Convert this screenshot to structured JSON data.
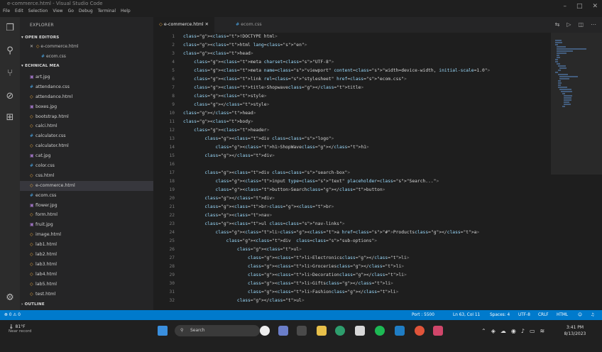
{
  "window": {
    "title": "e-commerce.html - Visual Studio Code"
  },
  "menu": [
    "File",
    "Edit",
    "Selection",
    "View",
    "Go",
    "Debug",
    "Terminal",
    "Help"
  ],
  "explorer": {
    "title": "EXPLORER",
    "open_editors_label": "OPEN EDITORS",
    "open_editors": [
      "e-commerce.html",
      "ecom.css"
    ],
    "folder_label": "ECHNICAL MEA",
    "files": [
      "art.jpg",
      "attendance.css",
      "attendance.html",
      "boxes.jpg",
      "bootstrap.html",
      "calci.html",
      "calculator.css",
      "calculator.html",
      "cat.jpg",
      "color.css",
      "css.html",
      "e-commerce.html",
      "ecom.css",
      "flower.jpg",
      "form.html",
      "fruit.jpg",
      "image.html",
      "lab1.html",
      "lab2.html",
      "lab3.html",
      "lab4.html",
      "lab5.html",
      "test.html"
    ],
    "selected_file": "e-commerce.html",
    "outline_label": "OUTLINE"
  },
  "tabs": [
    {
      "label": "e-commerce.html",
      "active": true
    },
    {
      "label": "ecom.css",
      "active": false
    }
  ],
  "editor": {
    "line_numbers": [
      "1",
      "2",
      "3",
      "4",
      "5",
      "6",
      "7",
      "8",
      "9",
      "10",
      "11",
      "12",
      "13",
      "14",
      "15",
      "16",
      "17",
      "18",
      "19",
      "20",
      "21",
      "22",
      "23",
      "24",
      "25",
      "26",
      "27",
      "28",
      "29",
      "30",
      "31",
      "32"
    ],
    "lines": [
      "<!DOCTYPE html>",
      "<html lang=\"en\">",
      "<head>",
      "    <meta charset=\"UTF-8\">",
      "    <meta name=\"viewport\" content=\"width=device-width, initial-scale=1.0\">",
      "    <link rel=\"stylesheet\" href=\"ecom.css\">",
      "    <title>Shopwave</title>",
      "    <style>",
      "    </style>",
      "</head>",
      "<body>",
      "    <header>",
      "        <div class=\"logo\">",
      "            <h1>ShopWave</h1>",
      "        </div>",
      "",
      "        <div class=\"search-box\">",
      "            <input type=\"text\" placeholder=\"Search...\">",
      "            <button>Search</button>",
      "        </div>",
      "        <br><br>",
      "        <nav>",
      "        <ul class=\"nav-links\">",
      "            <li><a href=\"#\">Products</a>",
      "                <div  class=\"sub-options\">",
      "                    <ul>",
      "                        <li>Electronics</li>",
      "                        <li>Groceries</li>",
      "                        <li>Decoration</li>",
      "                        <li>Gifts</li>",
      "                        <li>Fashion</li>",
      "                    </ul>"
    ]
  },
  "statusbar": {
    "left": "⊗ 0  ⚠ 0",
    "port": "Port : 5500",
    "position": "Ln 63, Col 11",
    "spaces": "Spaces: 4",
    "encoding": "UTF-8",
    "eol": "CRLF",
    "language": "HTML"
  },
  "taskbar": {
    "weather_temp": "81°F",
    "weather_desc": "Near record",
    "search_placeholder": "Search",
    "time": "3:41 PM",
    "date": "8/13/2023"
  },
  "colors": {
    "status_bar": "#007acc",
    "sidebar": "#252526",
    "editor": "#1e1e1e",
    "activity_bar": "#2c2c2c",
    "taskbar": "#202020"
  }
}
